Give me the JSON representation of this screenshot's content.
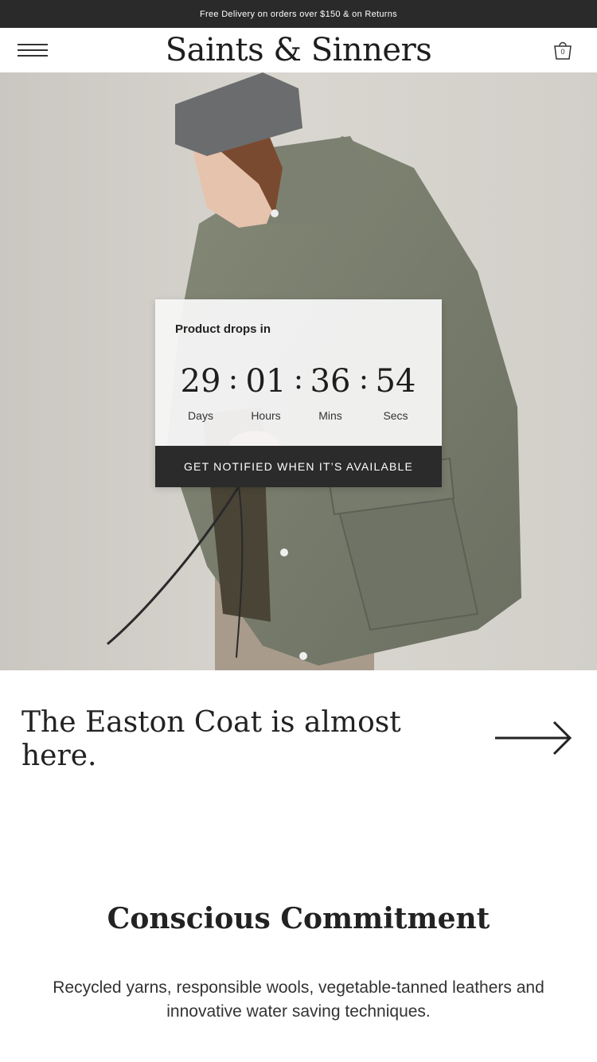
{
  "announcement": "Free Delivery on orders over $150 & on Returns",
  "header": {
    "brand": "Saints & Sinners",
    "cart_count": "0",
    "menu_icon": "hamburger-menu-icon",
    "cart_icon": "shopping-bag-icon"
  },
  "hero": {
    "image": "model-wearing-green-parka-photo",
    "countdown": {
      "title": "Product drops in",
      "days": "29",
      "hours": "01",
      "mins": "36",
      "secs": "54",
      "separator": ":",
      "labels": {
        "days": "Days",
        "hours": "Hours",
        "mins": "Mins",
        "secs": "Secs"
      },
      "button": "GET NOTIFIED WHEN IT’S AVAILABLE"
    }
  },
  "promo": {
    "text": "The Easton Coat is almost here.",
    "arrow_icon": "arrow-right-icon"
  },
  "commitment": {
    "title": "Conscious Commitment",
    "body": "Recycled yarns, responsible wools, vegetable-tanned leathers and innovative water saving techniques."
  },
  "colors": {
    "dark": "#2a2a2a",
    "coat": "#767a6c",
    "background": "#d4d1cb"
  }
}
